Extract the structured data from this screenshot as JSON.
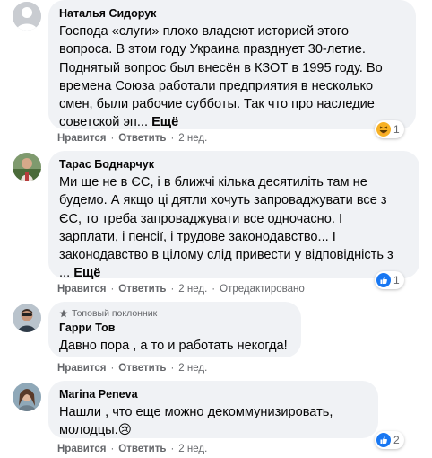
{
  "comments": [
    {
      "author": "Наталья Сидорук",
      "text": "Господа «слуги» плохо владеют историей этого\nвопроса. В этом году Украина празднует 30-летие.\nПоднятый вопрос был внесён в КЗОТ в 1995 году. Во\nвремена Союза работали предприятия в несколько\nсмен, были рабочие субботы. Так что про наследие\nсоветской эп... ",
      "more": "Ещё",
      "like": "Нравится",
      "reply": "Ответить",
      "time": "2 нед.",
      "reaction_icon": "haha-emoji-icon",
      "reaction_count": "1"
    },
    {
      "author": "Тарас Боднарчук",
      "text": "Ми ще не в ЄС, і в ближчі кілька десятиліть там не\nбудемо. А якщо ці дятли хочуть запроваджувати все з\nЄС, то треба запроваджувати все одночасно. І\nзарплати, і пенсії, і трудове законодавство... І\nзаконодавство в цілому слід привести у відповідність з\n... ",
      "more": "Ещё",
      "like": "Нравится",
      "reply": "Ответить",
      "time": "2 нед.",
      "edited": "Отредактировано",
      "reaction_icon": "like-thumb-icon",
      "reaction_count": "1"
    },
    {
      "badge": "Топовый поклонник",
      "author": "Гарри Тов",
      "text": "Давно пора , а то и работать некогда!",
      "like": "Нравится",
      "reply": "Ответить",
      "time": "2 нед."
    },
    {
      "author": "Marina Peneva",
      "text": "Нашли , что еще можно декоммунизировать,\nмолодцы.",
      "emoji": "😢",
      "like": "Нравится",
      "reply": "Ответить",
      "time": "2 нед.",
      "reaction_icon": "like-thumb-icon",
      "reaction_count": "2"
    }
  ],
  "colors": {
    "bubble": "#f0f2f5",
    "meta_text": "#65676b",
    "like_blue": "#1877f2",
    "haha_yellow": "#f7b125"
  }
}
